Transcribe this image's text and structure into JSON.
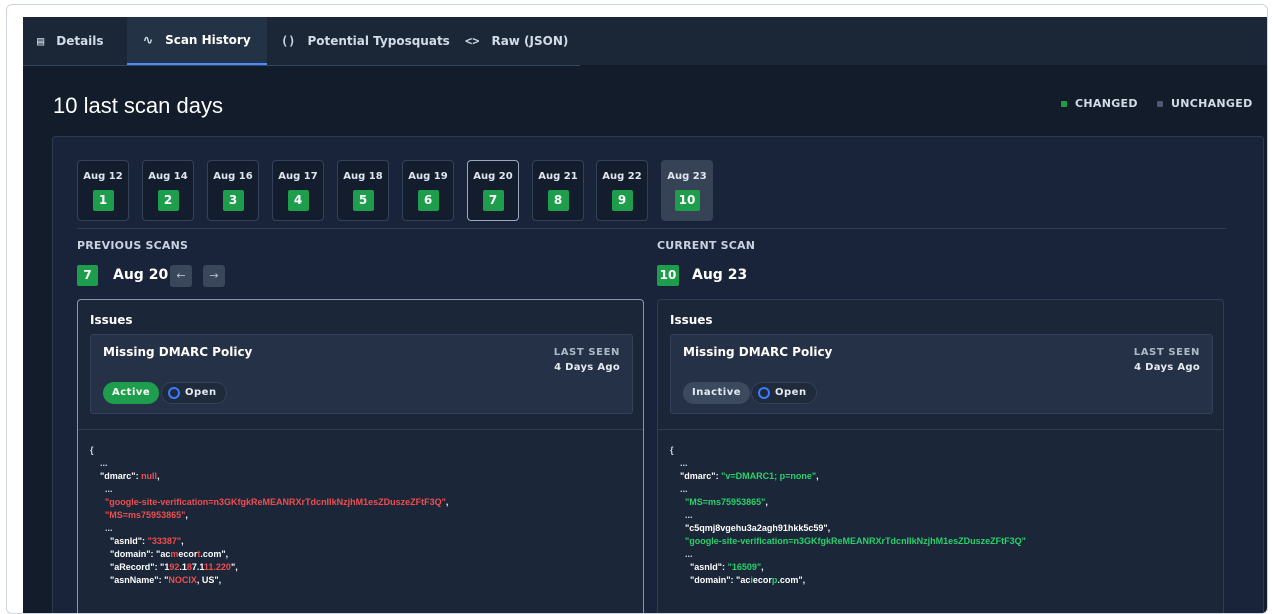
{
  "tabs": [
    {
      "label": "Details",
      "icon": "document-icon",
      "glyph": "▤"
    },
    {
      "label": "Scan History",
      "icon": "activity-icon",
      "glyph": "∿"
    },
    {
      "label": "Potential Typosquats",
      "icon": "parentheses-icon",
      "glyph": "()"
    },
    {
      "label": "Raw (JSON)",
      "icon": "code-brackets-icon",
      "glyph": "<>"
    }
  ],
  "heading": "10 last scan days",
  "legend": {
    "changed": "CHANGED",
    "unchanged": "UNCHANGED",
    "changed_color": "#1e9e4c",
    "unchanged_color": "#4b5a70"
  },
  "days": [
    {
      "label": "Aug 12",
      "num": "1"
    },
    {
      "label": "Aug 14",
      "num": "2"
    },
    {
      "label": "Aug 16",
      "num": "3"
    },
    {
      "label": "Aug 17",
      "num": "4"
    },
    {
      "label": "Aug 18",
      "num": "5"
    },
    {
      "label": "Aug 19",
      "num": "6"
    },
    {
      "label": "Aug 20",
      "num": "7"
    },
    {
      "label": "Aug 21",
      "num": "8"
    },
    {
      "label": "Aug 22",
      "num": "9"
    },
    {
      "label": "Aug 23",
      "num": "10"
    }
  ],
  "previous": {
    "section": "PREVIOUS SCANS",
    "num": "7",
    "date": "Aug 20",
    "prev_icon": "←",
    "next_icon": "→",
    "card_title": "Issues",
    "issue": "Missing DMARC Policy",
    "last_seen_label": "LAST SEEN",
    "last_seen": "4 Days Ago",
    "status": "Active",
    "state": "Open"
  },
  "current": {
    "section": "CURRENT SCAN",
    "num": "10",
    "date": "Aug 23",
    "card_title": "Issues",
    "issue": "Missing DMARC Policy",
    "last_seen_label": "LAST SEEN",
    "last_seen": "4 Days Ago",
    "status": "Inactive",
    "state": "Open"
  },
  "code_prev": [
    {
      "p": "{",
      "k": "",
      "v": "",
      "s": ""
    },
    {
      "p": "    ...",
      "k": "",
      "v": "",
      "s": ""
    },
    {
      "p": "    ",
      "k": "\"dmarc\": ",
      "v": "null",
      "s": ","
    },
    {
      "p": "      ...",
      "k": "",
      "v": "",
      "s": ""
    },
    {
      "p": "      ",
      "k": "",
      "v": "\"google-site-verification=n3GKfgkReMEANRXrTdcnIIkNzjhM1esZDuszeZFtF3Q\"",
      "s": ","
    },
    {
      "p": "      ",
      "k": "",
      "v": "\"MS=ms75953865\"",
      "s": ","
    },
    {
      "p": "      ...",
      "k": "",
      "v": "",
      "s": ""
    },
    {
      "p": "        ",
      "k": "\"asnId\": ",
      "v": "\"33387\"",
      "s": ","
    },
    {
      "p": "        ",
      "k": "\"domain\": \"ac",
      "v": "m",
      "s": "ecor",
      "v2": "t",
      "s2": ".com\","
    },
    {
      "p": "        ",
      "k": "\"aRecord\": \"1",
      "v": "92",
      "s": ".1",
      "v2": "8",
      "s2": "7.1",
      "v3": "11.220",
      "s3": "\","
    },
    {
      "p": "        ",
      "k": "\"asnName\": \"",
      "v": "NOCIX",
      "s": ", US\","
    }
  ],
  "code_curr": [
    {
      "p": "{",
      "k": "",
      "v": "",
      "s": ""
    },
    {
      "p": "    ...",
      "k": "",
      "v": "",
      "s": ""
    },
    {
      "p": "    ",
      "k": "\"dmarc\": ",
      "v": "\"v=DMARC1; p=none\"",
      "s": ","
    },
    {
      "p": "    ...",
      "k": "",
      "v": "",
      "s": ""
    },
    {
      "p": "      ",
      "k": "",
      "v": "\"MS=ms75953865\"",
      "s": ","
    },
    {
      "p": "      ...",
      "k": "",
      "v": "",
      "s": ""
    },
    {
      "p": "      ",
      "k": "\"c5qmj8vgehu3a2agh91hkk5c59\"",
      "v": "",
      "s": ","
    },
    {
      "p": "      ",
      "k": "",
      "v": "\"google-site-verification=n3GKfgkReMEANRXrTdcnIIkNzjhM1esZDuszeZFtF3Q\"",
      "s": ""
    },
    {
      "p": "      ...",
      "k": "",
      "v": "",
      "s": ""
    },
    {
      "p": "        ",
      "k": "\"asnId\": ",
      "v": "\"16509\"",
      "s": ","
    },
    {
      "p": "        ",
      "k": "\"domain\": \"ac",
      "v": "i",
      "s": "ecor",
      "v2": "p",
      "s2": ".com\","
    }
  ]
}
